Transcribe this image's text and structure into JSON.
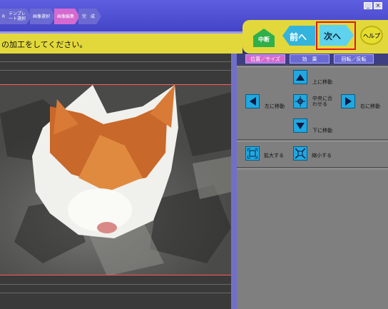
{
  "steps": [
    {
      "label": "R"
    },
    {
      "label": "テンプレート選択"
    },
    {
      "label": "画像選択"
    },
    {
      "label": "画像編集"
    },
    {
      "label": "完　成"
    }
  ],
  "window": {
    "minimize": "_",
    "close": "×"
  },
  "instruction": "の加工をしてください。",
  "nav": {
    "stop_label": "中断",
    "prev_label": "前へ",
    "next_label": "次へ",
    "help_label": "ヘルプ"
  },
  "tabs": [
    {
      "label": "位置／サイズ"
    },
    {
      "label": "効　果"
    },
    {
      "label": "回転／反転"
    }
  ],
  "position": {
    "up_label": "上に移動",
    "left_label": "左に移動",
    "center_label": "中央に合わせる",
    "right_label": "右に移動",
    "down_label": "下に移動"
  },
  "size": {
    "enlarge_label": "拡大する",
    "shrink_label": "縮小する"
  },
  "colors": {
    "step_active": "#d46ad0",
    "step_inactive": "#6a6ad2",
    "instruction_bar": "#e2d83c",
    "highlight": "#e01818",
    "arrow_button": "#20a8e0"
  }
}
